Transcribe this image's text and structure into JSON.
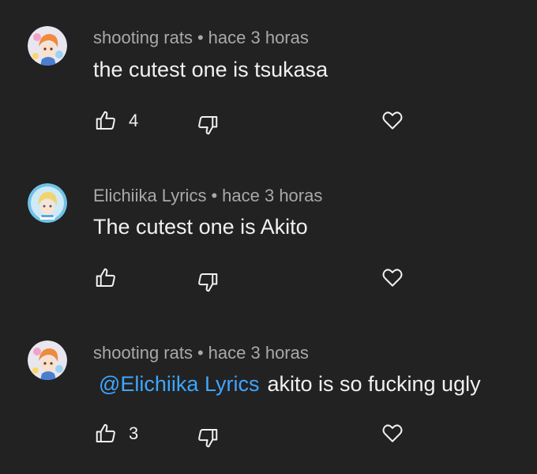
{
  "comments": [
    {
      "author": "shooting rats",
      "separator": "•",
      "time": "hace 3 horas",
      "mention": "",
      "text": "the cutest one is tsukasa",
      "likes": "4",
      "avatar": "anime-avatar-orange-hair"
    },
    {
      "author": "Elichiika Lyrics",
      "separator": "•",
      "time": "hace 3 horas",
      "mention": "",
      "text": "The cutest one is Akito",
      "likes": "",
      "avatar": "anime-avatar-blonde-hair"
    },
    {
      "author": "shooting rats",
      "separator": "•",
      "time": "hace 3 horas",
      "mention": "@Elichiika Lyrics",
      "text": "akito is so fucking ugly",
      "likes": "3",
      "avatar": "anime-avatar-orange-hair"
    }
  ],
  "colors": {
    "background": "#222222",
    "mention": "#3ea6ff",
    "meta": "#a9a9a9",
    "text": "#f1f1f1"
  }
}
